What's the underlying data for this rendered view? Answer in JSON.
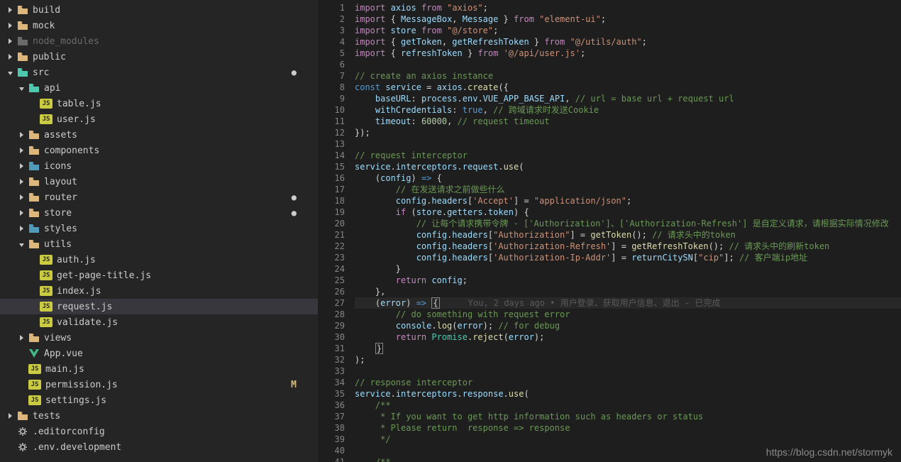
{
  "watermark": "https://blog.csdn.net/stormyk",
  "tree": [
    {
      "depth": 0,
      "arrow": "r",
      "icon": "folder",
      "cls": "folder-ic",
      "label": "build"
    },
    {
      "depth": 0,
      "arrow": "r",
      "icon": "folder",
      "cls": "folder-ic",
      "label": "mock"
    },
    {
      "depth": 0,
      "arrow": "r",
      "icon": "folder",
      "cls": "folder-dim",
      "label": "node_modules",
      "dim": true
    },
    {
      "depth": 0,
      "arrow": "r",
      "icon": "folder",
      "cls": "folder-ic",
      "label": "public"
    },
    {
      "depth": 0,
      "arrow": "d",
      "icon": "folder",
      "cls": "folder-green",
      "label": "src",
      "dot": true
    },
    {
      "depth": 1,
      "arrow": "d",
      "icon": "folder",
      "cls": "folder-green",
      "label": "api"
    },
    {
      "depth": 2,
      "arrow": "",
      "icon": "js",
      "label": "table.js"
    },
    {
      "depth": 2,
      "arrow": "",
      "icon": "js",
      "label": "user.js"
    },
    {
      "depth": 1,
      "arrow": "r",
      "icon": "folder",
      "cls": "folder-ic",
      "label": "assets"
    },
    {
      "depth": 1,
      "arrow": "r",
      "icon": "folder",
      "cls": "folder-ic",
      "label": "components"
    },
    {
      "depth": 1,
      "arrow": "r",
      "icon": "folder",
      "cls": "folder-blue",
      "label": "icons"
    },
    {
      "depth": 1,
      "arrow": "r",
      "icon": "folder",
      "cls": "folder-ic",
      "label": "layout"
    },
    {
      "depth": 1,
      "arrow": "r",
      "icon": "folder",
      "cls": "folder-ic",
      "label": "router",
      "dot": true
    },
    {
      "depth": 1,
      "arrow": "r",
      "icon": "folder",
      "cls": "folder-ic",
      "label": "store",
      "dot": true
    },
    {
      "depth": 1,
      "arrow": "r",
      "icon": "folder",
      "cls": "folder-blue",
      "label": "styles"
    },
    {
      "depth": 1,
      "arrow": "d",
      "icon": "folder",
      "cls": "folder-ic",
      "label": "utils"
    },
    {
      "depth": 2,
      "arrow": "",
      "icon": "js",
      "label": "auth.js"
    },
    {
      "depth": 2,
      "arrow": "",
      "icon": "js",
      "label": "get-page-title.js"
    },
    {
      "depth": 2,
      "arrow": "",
      "icon": "js",
      "label": "index.js"
    },
    {
      "depth": 2,
      "arrow": "",
      "icon": "js",
      "label": "request.js",
      "selected": true
    },
    {
      "depth": 2,
      "arrow": "",
      "icon": "js",
      "label": "validate.js"
    },
    {
      "depth": 1,
      "arrow": "r",
      "icon": "folder",
      "cls": "folder-ic",
      "label": "views"
    },
    {
      "depth": 1,
      "arrow": "",
      "icon": "vue",
      "label": "App.vue"
    },
    {
      "depth": 1,
      "arrow": "",
      "icon": "js",
      "label": "main.js"
    },
    {
      "depth": 1,
      "arrow": "",
      "icon": "js",
      "label": "permission.js",
      "mod": "M"
    },
    {
      "depth": 1,
      "arrow": "",
      "icon": "js",
      "label": "settings.js"
    },
    {
      "depth": 0,
      "arrow": "r",
      "icon": "folder",
      "cls": "folder-ic",
      "label": "tests"
    },
    {
      "depth": 0,
      "arrow": "",
      "icon": "conf",
      "label": ".editorconfig"
    },
    {
      "depth": 0,
      "arrow": "",
      "icon": "conf",
      "label": ".env.development"
    }
  ],
  "blame": "You, 2 days ago • 用户登录、获取用户信息、退出 - 已完成",
  "code": [
    [
      [
        "kw",
        "import"
      ],
      [
        "punc",
        " "
      ],
      [
        "ident",
        "axios"
      ],
      [
        "punc",
        " "
      ],
      [
        "kw",
        "from"
      ],
      [
        "punc",
        " "
      ],
      [
        "str",
        "\"axios\""
      ],
      [
        "punc",
        ";"
      ]
    ],
    [
      [
        "kw",
        "import"
      ],
      [
        "punc",
        " { "
      ],
      [
        "ident",
        "MessageBox"
      ],
      [
        "punc",
        ", "
      ],
      [
        "ident",
        "Message"
      ],
      [
        "punc",
        " } "
      ],
      [
        "kw",
        "from"
      ],
      [
        "punc",
        " "
      ],
      [
        "str",
        "\"element-ui\""
      ],
      [
        "punc",
        ";"
      ]
    ],
    [
      [
        "kw",
        "import"
      ],
      [
        "punc",
        " "
      ],
      [
        "ident",
        "store"
      ],
      [
        "punc",
        " "
      ],
      [
        "kw",
        "from"
      ],
      [
        "punc",
        " "
      ],
      [
        "str",
        "\"@/store\""
      ],
      [
        "punc",
        ";"
      ]
    ],
    [
      [
        "kw",
        "import"
      ],
      [
        "punc",
        " { "
      ],
      [
        "ident",
        "getToken"
      ],
      [
        "punc",
        ", "
      ],
      [
        "ident",
        "getRefreshToken"
      ],
      [
        "punc",
        " } "
      ],
      [
        "kw",
        "from"
      ],
      [
        "punc",
        " "
      ],
      [
        "str",
        "\"@/utils/auth\""
      ],
      [
        "punc",
        ";"
      ]
    ],
    [
      [
        "kw",
        "import"
      ],
      [
        "punc",
        " { "
      ],
      [
        "ident",
        "refreshToken"
      ],
      [
        "punc",
        " } "
      ],
      [
        "kw",
        "from"
      ],
      [
        "punc",
        " "
      ],
      [
        "str",
        "'@/api/user.js'"
      ],
      [
        "punc",
        ";"
      ]
    ],
    [],
    [
      [
        "cmt",
        "// create an axios instance"
      ]
    ],
    [
      [
        "const",
        "const"
      ],
      [
        "punc",
        " "
      ],
      [
        "ident",
        "service"
      ],
      [
        "punc",
        " = "
      ],
      [
        "ident",
        "axios"
      ],
      [
        "punc",
        "."
      ],
      [
        "fn",
        "create"
      ],
      [
        "punc",
        "({"
      ]
    ],
    [
      [
        "punc",
        "    "
      ],
      [
        "prop",
        "baseURL"
      ],
      [
        "punc",
        ": "
      ],
      [
        "ident",
        "process"
      ],
      [
        "punc",
        "."
      ],
      [
        "ident",
        "env"
      ],
      [
        "punc",
        "."
      ],
      [
        "ident",
        "VUE_APP_BASE_API"
      ],
      [
        "punc",
        ", "
      ],
      [
        "cmt",
        "// url = base url + request url"
      ]
    ],
    [
      [
        "punc",
        "    "
      ],
      [
        "prop",
        "withCredentials"
      ],
      [
        "punc",
        ": "
      ],
      [
        "const",
        "true"
      ],
      [
        "punc",
        ", "
      ],
      [
        "cmt",
        "// 跨域请求时发送Cookie"
      ]
    ],
    [
      [
        "punc",
        "    "
      ],
      [
        "prop",
        "timeout"
      ],
      [
        "punc",
        ": "
      ],
      [
        "num",
        "60000"
      ],
      [
        "punc",
        ", "
      ],
      [
        "cmt",
        "// request timeout"
      ]
    ],
    [
      [
        "punc",
        "});"
      ]
    ],
    [],
    [
      [
        "cmt",
        "// request interceptor"
      ]
    ],
    [
      [
        "ident",
        "service"
      ],
      [
        "punc",
        "."
      ],
      [
        "ident",
        "interceptors"
      ],
      [
        "punc",
        "."
      ],
      [
        "ident",
        "request"
      ],
      [
        "punc",
        "."
      ],
      [
        "fn",
        "use"
      ],
      [
        "punc",
        "("
      ]
    ],
    [
      [
        "punc",
        "    ("
      ],
      [
        "ident",
        "config"
      ],
      [
        "punc",
        ") "
      ],
      [
        "const",
        "=>"
      ],
      [
        "punc",
        " {"
      ]
    ],
    [
      [
        "punc",
        "        "
      ],
      [
        "cmt",
        "// 在发送请求之前做些什么"
      ]
    ],
    [
      [
        "punc",
        "        "
      ],
      [
        "ident",
        "config"
      ],
      [
        "punc",
        "."
      ],
      [
        "ident",
        "headers"
      ],
      [
        "punc",
        "["
      ],
      [
        "str",
        "'Accept'"
      ],
      [
        "punc",
        "] = "
      ],
      [
        "str",
        "\"application/json\""
      ],
      [
        "punc",
        ";"
      ]
    ],
    [
      [
        "punc",
        "        "
      ],
      [
        "kw",
        "if"
      ],
      [
        "punc",
        " ("
      ],
      [
        "ident",
        "store"
      ],
      [
        "punc",
        "."
      ],
      [
        "ident",
        "getters"
      ],
      [
        "punc",
        "."
      ],
      [
        "ident",
        "token"
      ],
      [
        "punc",
        ") {"
      ]
    ],
    [
      [
        "punc",
        "            "
      ],
      [
        "cmt",
        "// 让每个请求携带令牌 - ['Authorization']、['Authorization-Refresh'] 是自定义请求，请根据实际情况修改"
      ]
    ],
    [
      [
        "punc",
        "            "
      ],
      [
        "ident",
        "config"
      ],
      [
        "punc",
        "."
      ],
      [
        "ident",
        "headers"
      ],
      [
        "punc",
        "["
      ],
      [
        "str",
        "\"Authorization\""
      ],
      [
        "punc",
        "] = "
      ],
      [
        "fn",
        "getToken"
      ],
      [
        "punc",
        "(); "
      ],
      [
        "cmt",
        "// 请求头中的token"
      ]
    ],
    [
      [
        "punc",
        "            "
      ],
      [
        "ident",
        "config"
      ],
      [
        "punc",
        "."
      ],
      [
        "ident",
        "headers"
      ],
      [
        "punc",
        "["
      ],
      [
        "str",
        "'Authorization-Refresh'"
      ],
      [
        "punc",
        "] = "
      ],
      [
        "fn",
        "getRefreshToken"
      ],
      [
        "punc",
        "(); "
      ],
      [
        "cmt",
        "// 请求头中的刷新token"
      ]
    ],
    [
      [
        "punc",
        "            "
      ],
      [
        "ident",
        "config"
      ],
      [
        "punc",
        "."
      ],
      [
        "ident",
        "headers"
      ],
      [
        "punc",
        "["
      ],
      [
        "str",
        "'Authorization-Ip-Addr'"
      ],
      [
        "punc",
        "] = "
      ],
      [
        "ident",
        "returnCitySN"
      ],
      [
        "punc",
        "["
      ],
      [
        "str",
        "\"cip\""
      ],
      [
        "punc",
        "]; "
      ],
      [
        "cmt",
        "// 客户端ip地址"
      ]
    ],
    [
      [
        "punc",
        "        }"
      ]
    ],
    [
      [
        "punc",
        "        "
      ],
      [
        "kw",
        "return"
      ],
      [
        "punc",
        " "
      ],
      [
        "ident",
        "config"
      ],
      [
        "punc",
        ";"
      ]
    ],
    [
      [
        "punc",
        "    },"
      ]
    ],
    [
      [
        "punc",
        "    ("
      ],
      [
        "ident",
        "error"
      ],
      [
        "punc",
        ") "
      ],
      [
        "const",
        "=>"
      ],
      [
        "punc",
        " "
      ],
      [
        "box",
        "{"
      ],
      [
        "blame",
        "__BLAME__"
      ]
    ],
    [
      [
        "punc",
        "        "
      ],
      [
        "cmt",
        "// do something with request error"
      ]
    ],
    [
      [
        "punc",
        "        "
      ],
      [
        "ident",
        "console"
      ],
      [
        "punc",
        "."
      ],
      [
        "fn",
        "log"
      ],
      [
        "punc",
        "("
      ],
      [
        "ident",
        "error"
      ],
      [
        "punc",
        "); "
      ],
      [
        "cmt",
        "// for debug"
      ]
    ],
    [
      [
        "punc",
        "        "
      ],
      [
        "kw",
        "return"
      ],
      [
        "punc",
        " "
      ],
      [
        "type",
        "Promise"
      ],
      [
        "punc",
        "."
      ],
      [
        "fn",
        "reject"
      ],
      [
        "punc",
        "("
      ],
      [
        "ident",
        "error"
      ],
      [
        "punc",
        ");"
      ]
    ],
    [
      [
        "punc",
        "    "
      ],
      [
        "box",
        "}"
      ]
    ],
    [
      [
        "punc",
        ");"
      ]
    ],
    [],
    [
      [
        "cmt",
        "// response interceptor"
      ]
    ],
    [
      [
        "ident",
        "service"
      ],
      [
        "punc",
        "."
      ],
      [
        "ident",
        "interceptors"
      ],
      [
        "punc",
        "."
      ],
      [
        "ident",
        "response"
      ],
      [
        "punc",
        "."
      ],
      [
        "fn",
        "use"
      ],
      [
        "punc",
        "("
      ]
    ],
    [
      [
        "punc",
        "    "
      ],
      [
        "cmt",
        "/**"
      ]
    ],
    [
      [
        "punc",
        "    "
      ],
      [
        "cmt",
        " * If you want to get http information such as headers or status"
      ]
    ],
    [
      [
        "punc",
        "    "
      ],
      [
        "cmt",
        " * Please return  response => response"
      ]
    ],
    [
      [
        "punc",
        "    "
      ],
      [
        "cmt",
        " */"
      ]
    ],
    [],
    [
      [
        "punc",
        "    "
      ],
      [
        "cmt",
        "/**"
      ]
    ]
  ]
}
